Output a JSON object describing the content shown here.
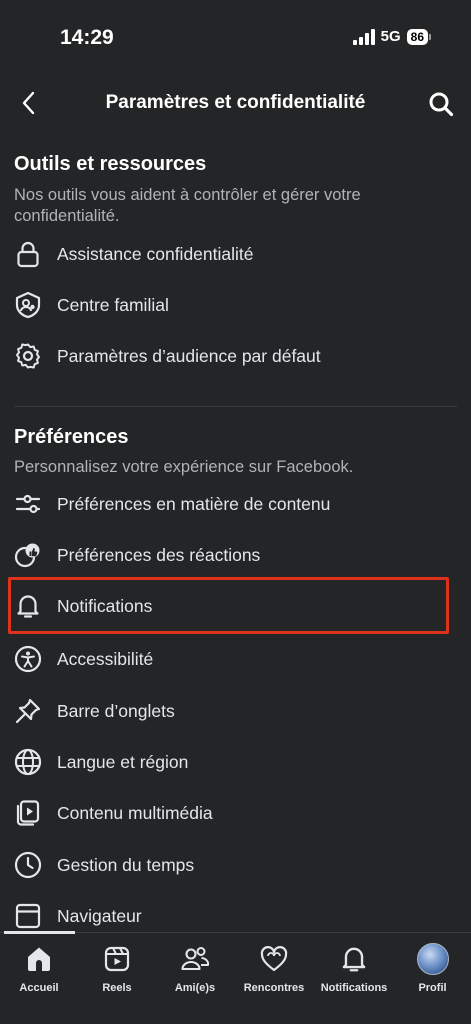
{
  "status_bar": {
    "time": "14:29",
    "network": "5G",
    "battery": "86"
  },
  "header": {
    "title": "Paramètres et confidentialité",
    "back_icon": "chevron-left-icon",
    "search_icon": "search-icon"
  },
  "tools_section": {
    "title": "Outils et ressources",
    "description": "Nos outils vous aident à contrôler et gérer votre confidentialité.",
    "items": [
      {
        "label": "Assistance confidentialité",
        "icon": "lock-icon"
      },
      {
        "label": "Centre familial",
        "icon": "family-center-icon"
      },
      {
        "label": "Paramètres d’audience par défaut",
        "icon": "gear-icon"
      }
    ]
  },
  "preferences_section": {
    "title": "Préférences",
    "description": "Personnalisez votre expérience sur Facebook.",
    "items": [
      {
        "label": "Préférences en matière de contenu",
        "icon": "sliders-icon"
      },
      {
        "label": "Préférences des réactions",
        "icon": "reactions-icon"
      },
      {
        "label": "Notifications",
        "icon": "bell-icon",
        "highlighted": true
      },
      {
        "label": "Accessibilité",
        "icon": "accessibility-icon"
      },
      {
        "label": "Barre d’onglets",
        "icon": "pin-icon"
      },
      {
        "label": "Langue et région",
        "icon": "globe-icon"
      },
      {
        "label": "Contenu multimédia",
        "icon": "media-icon"
      },
      {
        "label": "Gestion du temps",
        "icon": "clock-icon"
      },
      {
        "label": "Navigateur",
        "icon": "browser-icon"
      }
    ]
  },
  "bottom_nav": {
    "active": "Accueil",
    "items": [
      {
        "label": "Accueil",
        "icon": "home-icon"
      },
      {
        "label": "Reels",
        "icon": "reels-icon"
      },
      {
        "label": "Ami(e)s",
        "icon": "friends-icon"
      },
      {
        "label": "Rencontres",
        "icon": "dating-heart-icon"
      },
      {
        "label": "Notifications",
        "icon": "bell-icon"
      },
      {
        "label": "Profil",
        "icon": "avatar"
      }
    ]
  },
  "colors": {
    "background": "#242526",
    "text": "#e4e6eb",
    "secondary_text": "#b0b3b8",
    "highlight_border": "#e0311d"
  }
}
